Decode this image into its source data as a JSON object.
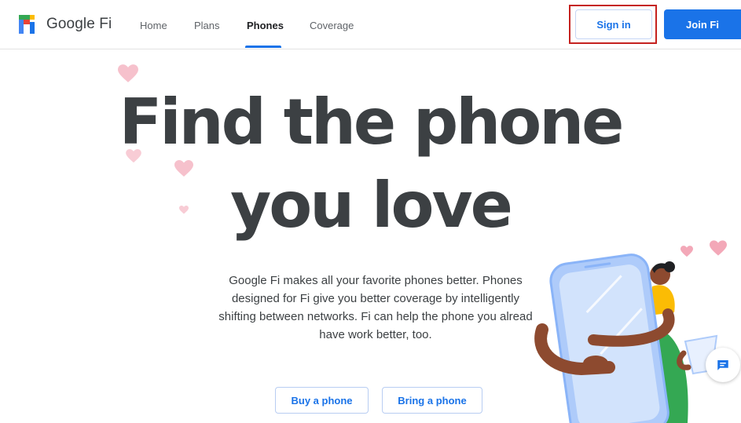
{
  "header": {
    "brand": "Google Fi",
    "nav": [
      {
        "label": "Home"
      },
      {
        "label": "Plans"
      },
      {
        "label": "Phones"
      },
      {
        "label": "Coverage"
      }
    ],
    "active_nav": "Phones",
    "sign_in_label": "Sign in",
    "join_label": "Join Fi"
  },
  "hero": {
    "title_line1": "Find the phone",
    "title_line2": "you love",
    "description_lines": [
      "Google Fi makes all your favorite phones better. Phones",
      "designed for Fi give you better coverage by intelligently",
      "shifting between networks. Fi can help the phone you alread",
      "have work better, too."
    ],
    "buy_label": "Buy a phone",
    "bring_label": "Bring a phone"
  },
  "icons": {
    "logo": "google-fi-logo-icon",
    "hearts": "heart-icon",
    "chat": "chat-icon",
    "illustration": "person-hugging-phone-illustration"
  },
  "colors": {
    "accent": "#1a73e8",
    "heading": "#3c4043",
    "heart": "#f6c1cc",
    "highlight_outline": "#c5221f"
  }
}
